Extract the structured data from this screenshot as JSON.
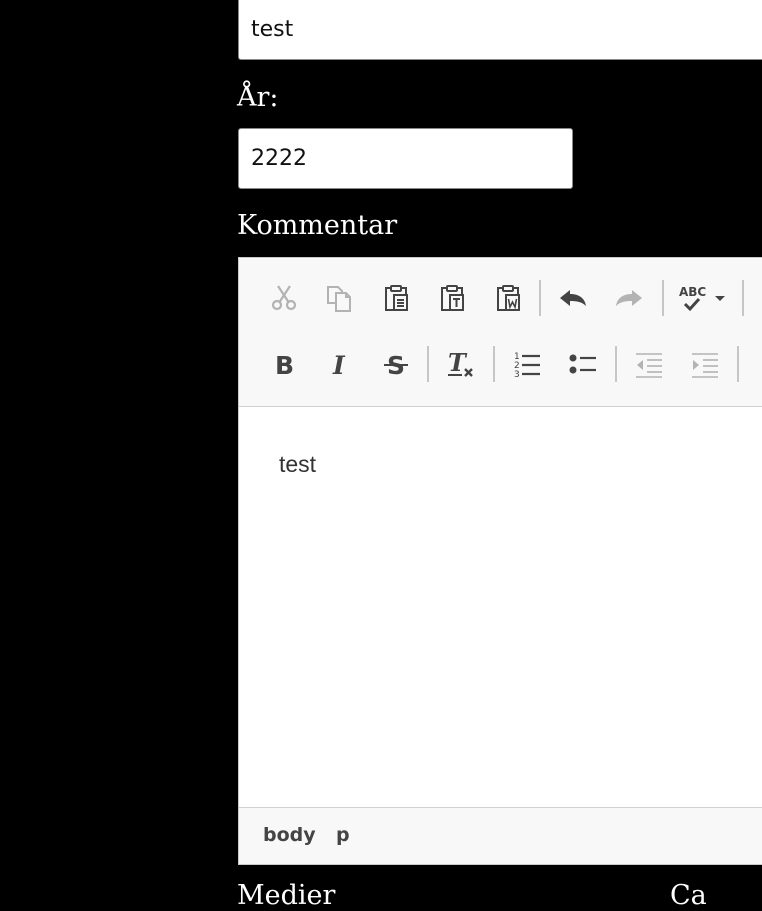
{
  "form": {
    "name_value": "test",
    "year_label": "År:",
    "year_value": "2222",
    "comment_label": "Kommentar",
    "bottom_label_1": "Medier",
    "bottom_label_2": "Ca"
  },
  "editor": {
    "content": "test",
    "statusbar": {
      "path": [
        "body",
        "p"
      ]
    },
    "toolbar_icons": {
      "row1": [
        "cut-icon",
        "copy-icon",
        "paste-icon",
        "paste-text-icon",
        "paste-from-word-icon",
        "undo-icon",
        "redo-icon",
        "spellcheck-icon"
      ],
      "row2": [
        "bold-icon",
        "italic-icon",
        "strikethrough-icon",
        "remove-format-icon",
        "numbered-list-icon",
        "bulleted-list-icon",
        "outdent-icon",
        "indent-icon"
      ]
    },
    "colors": {
      "icon_active": "#444444",
      "icon_disabled": "#b3b3b3",
      "toolbar_bg": "#f8f8f8"
    }
  }
}
